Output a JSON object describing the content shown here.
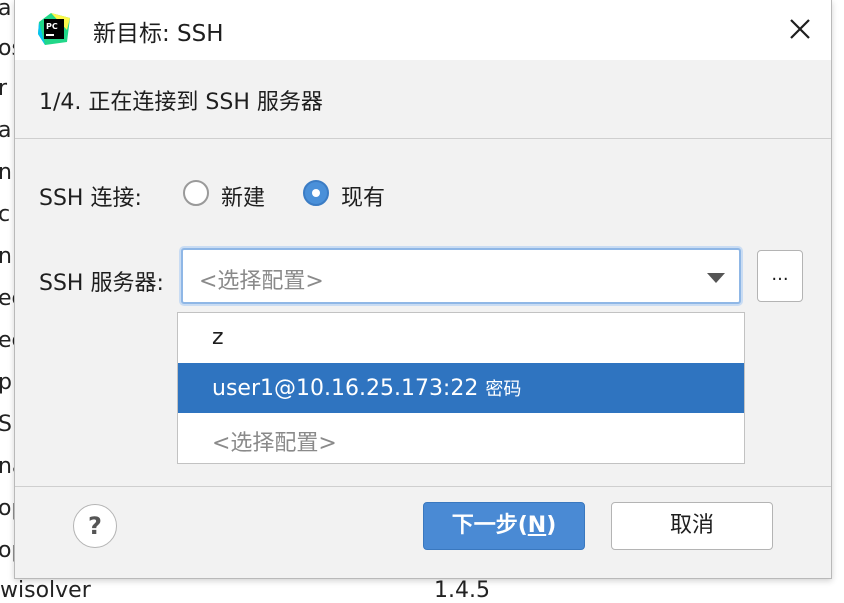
{
  "background": {
    "letters": [
      "a",
      "os",
      "r",
      "a",
      "n",
      "c",
      "n",
      "ec",
      "ec",
      "p",
      "Sp",
      "na",
      "op",
      "op"
    ],
    "bottom_left": "wisolver",
    "bottom_right": "1.4.5"
  },
  "dialog": {
    "title": "新目标: SSH",
    "step": "1/4. 正在连接到 SSH 服务器",
    "ssh_connection_label": "SSH 连接:",
    "radio_new": "新建",
    "radio_existing": "现有",
    "selected_radio": "existing",
    "ssh_server_label": "SSH 服务器:",
    "combo_placeholder": "<选择配置>",
    "browse_label": "...",
    "dropdown_items": [
      {
        "main": "z",
        "sub": ""
      },
      {
        "main": "user1@10.16.25.173:22",
        "sub": "密码"
      },
      {
        "main": "<选择配置>",
        "sub": ""
      }
    ],
    "selected_item": 1,
    "help_label": "?",
    "next_label_prefix": "下一步(",
    "next_mnemonic": "N",
    "next_label_suffix": ")",
    "cancel_label": "取消"
  },
  "colors": {
    "accent": "#4a8ad4",
    "selection": "#2f74c0"
  }
}
